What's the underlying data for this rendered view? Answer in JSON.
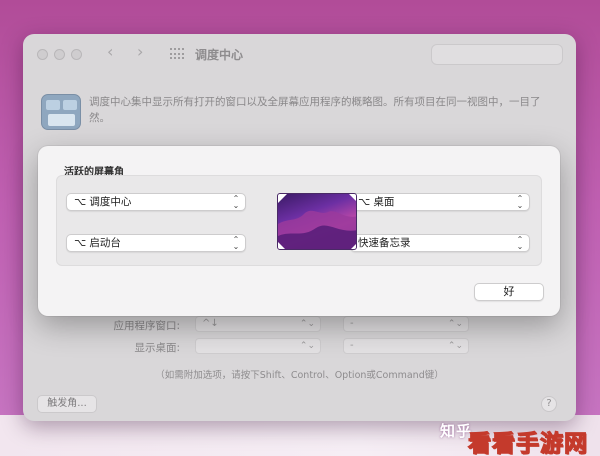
{
  "window": {
    "title": "调度中心",
    "description": "调度中心集中显示所有打开的窗口以及全屏幕应用程序的概略图。所有项目在同一视图中，一目了然。",
    "rows": [
      {
        "label": "应用程序窗口:",
        "shortcut": "^↓",
        "option": "-"
      },
      {
        "label": "显示桌面:",
        "shortcut": "",
        "option": "-"
      }
    ],
    "hint": "（如需附加选项，请按下Shift、Control、Option或Command键）",
    "hot_corners_button": "触发角...",
    "help_label": "?"
  },
  "sheet": {
    "title": "活跃的屏幕角",
    "top_left": "⌥ 调度中心",
    "top_right": "⌥ 桌面",
    "bottom_left": "⌥ 启动台",
    "bottom_right": "快速备忘录",
    "ok_label": "好"
  },
  "watermark": {
    "left": "知乎",
    "right": "看看手游网"
  },
  "colors": {
    "background": "#b14c98",
    "sheet": "#f4f3f4",
    "accent": "#c43a2c"
  }
}
